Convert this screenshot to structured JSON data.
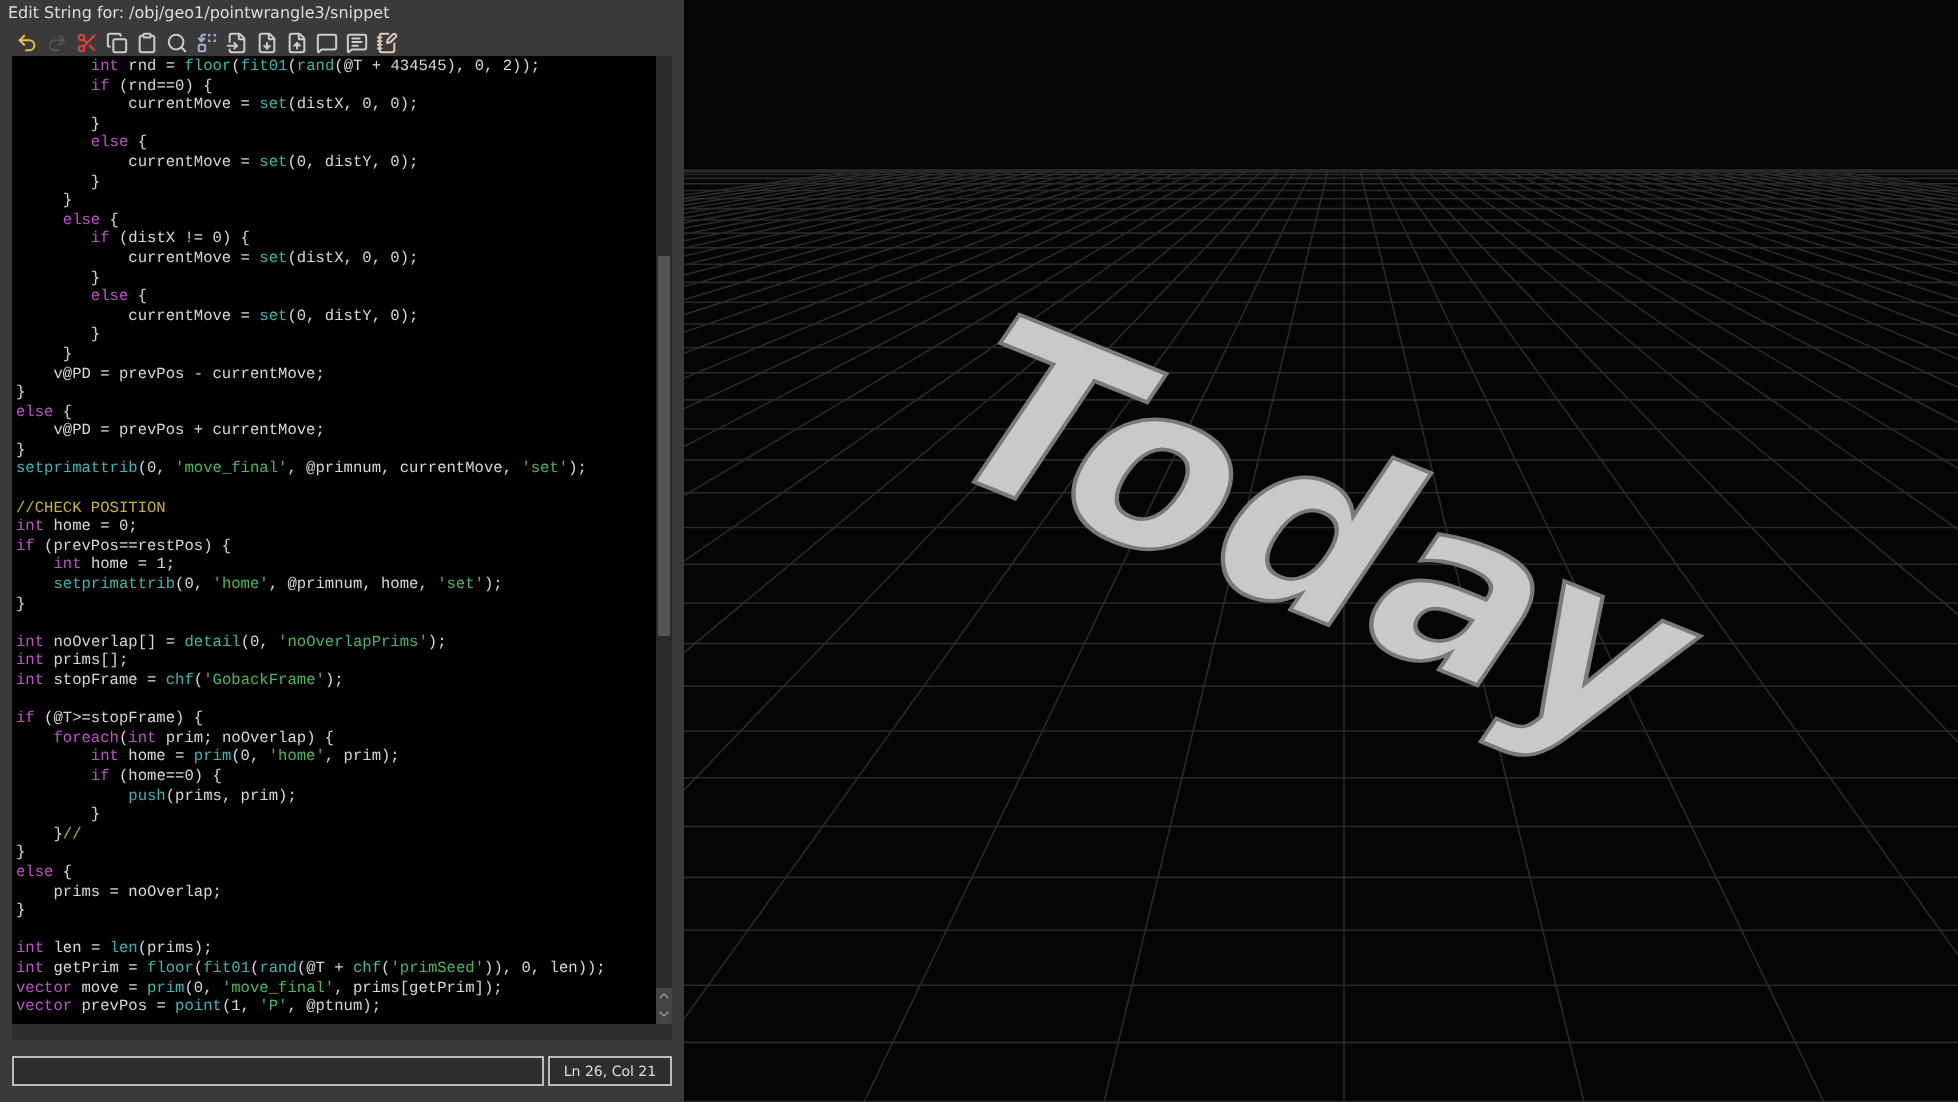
{
  "editor": {
    "title": "Edit String for: /obj/geo1/pointwrangle3/snippet",
    "toolbar": [
      {
        "disabled": false
      },
      {
        "disabled": true
      },
      {
        "disabled": false
      },
      {
        "disabled": false
      },
      {
        "disabled": false
      },
      {
        "disabled": false
      },
      {
        "disabled": false
      },
      {
        "disabled": false
      },
      {
        "disabled": false
      },
      {
        "disabled": false
      },
      {
        "disabled": false
      },
      {
        "disabled": false
      },
      {
        "disabled": false
      }
    ],
    "lines": [
      {
        "kind": "code",
        "tokens": [
          {
            "kind": "keyword",
            "text": "        int"
          },
          {
            "kind": "plain",
            "text": " rnd = "
          },
          {
            "kind": "func",
            "text": "floor"
          },
          {
            "kind": "plain",
            "text": "("
          },
          {
            "kind": "func",
            "text": "fit01"
          },
          {
            "kind": "plain",
            "text": "("
          },
          {
            "kind": "func",
            "text": "rand"
          },
          {
            "kind": "plain",
            "text": "(@T + 434545), 0, 2));"
          }
        ]
      },
      {
        "kind": "code",
        "tokens": [
          {
            "kind": "keyword",
            "text": "        if"
          },
          {
            "kind": "plain",
            "text": " (rnd==0) {"
          }
        ]
      },
      {
        "kind": "code",
        "tokens": [
          {
            "kind": "plain",
            "text": "            currentMove = "
          },
          {
            "kind": "func",
            "text": "set"
          },
          {
            "kind": "plain",
            "text": "(distX, 0, 0);"
          }
        ]
      },
      {
        "kind": "code",
        "tokens": [
          {
            "kind": "plain",
            "text": "        }"
          }
        ]
      },
      {
        "kind": "code",
        "tokens": [
          {
            "kind": "keyword",
            "text": "        else"
          },
          {
            "kind": "plain",
            "text": " {"
          }
        ]
      },
      {
        "kind": "code",
        "tokens": [
          {
            "kind": "plain",
            "text": "            currentMove = "
          },
          {
            "kind": "func",
            "text": "set"
          },
          {
            "kind": "plain",
            "text": "(0, distY, 0);"
          }
        ]
      },
      {
        "kind": "code",
        "tokens": [
          {
            "kind": "plain",
            "text": "        }"
          }
        ]
      },
      {
        "kind": "code",
        "tokens": [
          {
            "kind": "plain",
            "text": "     }"
          }
        ]
      },
      {
        "kind": "code",
        "tokens": [
          {
            "kind": "keyword",
            "text": "     else"
          },
          {
            "kind": "plain",
            "text": " {"
          }
        ]
      },
      {
        "kind": "code",
        "tokens": [
          {
            "kind": "keyword",
            "text": "        if"
          },
          {
            "kind": "plain",
            "text": " (distX != 0) {"
          }
        ]
      },
      {
        "kind": "code",
        "tokens": [
          {
            "kind": "plain",
            "text": "            currentMove = "
          },
          {
            "kind": "func",
            "text": "set"
          },
          {
            "kind": "plain",
            "text": "(distX, 0, 0);"
          }
        ]
      },
      {
        "kind": "code",
        "tokens": [
          {
            "kind": "plain",
            "text": "        }"
          }
        ]
      },
      {
        "kind": "code",
        "tokens": [
          {
            "kind": "keyword",
            "text": "        else"
          },
          {
            "kind": "plain",
            "text": " {"
          }
        ]
      },
      {
        "kind": "code",
        "tokens": [
          {
            "kind": "plain",
            "text": "            currentMove = "
          },
          {
            "kind": "func",
            "text": "set"
          },
          {
            "kind": "plain",
            "text": "(0, distY, 0);"
          }
        ]
      },
      {
        "kind": "code",
        "tokens": [
          {
            "kind": "plain",
            "text": "        }"
          }
        ]
      },
      {
        "kind": "code",
        "tokens": [
          {
            "kind": "plain",
            "text": "     }"
          }
        ]
      },
      {
        "kind": "code",
        "tokens": [
          {
            "kind": "plain",
            "text": "    v@PD = prevPos - currentMove;"
          }
        ]
      },
      {
        "kind": "code",
        "tokens": [
          {
            "kind": "plain",
            "text": "}"
          }
        ]
      },
      {
        "kind": "code",
        "tokens": [
          {
            "kind": "keyword",
            "text": "else"
          },
          {
            "kind": "plain",
            "text": " {"
          }
        ]
      },
      {
        "kind": "code",
        "tokens": [
          {
            "kind": "plain",
            "text": "    v@PD = prevPos + currentMove;"
          }
        ]
      },
      {
        "kind": "code",
        "tokens": [
          {
            "kind": "plain",
            "text": "}"
          }
        ]
      },
      {
        "kind": "code",
        "tokens": [
          {
            "kind": "func",
            "text": "setprimattrib"
          },
          {
            "kind": "plain",
            "text": "(0, "
          },
          {
            "kind": "string",
            "text": "'move_final'"
          },
          {
            "kind": "plain",
            "text": ", @primnum, currentMove, "
          },
          {
            "kind": "string",
            "text": "'set'"
          },
          {
            "kind": "plain",
            "text": ");"
          }
        ]
      },
      {
        "kind": "blank"
      },
      {
        "kind": "code",
        "tokens": [
          {
            "kind": "comment",
            "text": "//CHECK POSITION"
          }
        ]
      },
      {
        "kind": "code",
        "tokens": [
          {
            "kind": "keyword",
            "text": "int"
          },
          {
            "kind": "plain",
            "text": " home = 0;"
          }
        ]
      },
      {
        "kind": "code",
        "tokens": [
          {
            "kind": "keyword",
            "text": "if"
          },
          {
            "kind": "plain",
            "text": " (prevPos==restPos) {"
          }
        ]
      },
      {
        "kind": "code",
        "tokens": [
          {
            "kind": "keyword",
            "text": "    int"
          },
          {
            "kind": "plain",
            "text": " home = 1;"
          }
        ]
      },
      {
        "kind": "code",
        "tokens": [
          {
            "kind": "func",
            "text": "    setprimattrib"
          },
          {
            "kind": "plain",
            "text": "(0, "
          },
          {
            "kind": "string",
            "text": "'home'"
          },
          {
            "kind": "plain",
            "text": ", @primnum, home, "
          },
          {
            "kind": "string",
            "text": "'set'"
          },
          {
            "kind": "plain",
            "text": ");"
          }
        ]
      },
      {
        "kind": "code",
        "tokens": [
          {
            "kind": "plain",
            "text": "}"
          }
        ]
      },
      {
        "kind": "blank"
      },
      {
        "kind": "code",
        "tokens": [
          {
            "kind": "keyword",
            "text": "int"
          },
          {
            "kind": "plain",
            "text": " noOverlap[] = "
          },
          {
            "kind": "func",
            "text": "detail"
          },
          {
            "kind": "plain",
            "text": "(0, "
          },
          {
            "kind": "string",
            "text": "'noOverlapPrims'"
          },
          {
            "kind": "plain",
            "text": ");"
          }
        ]
      },
      {
        "kind": "code",
        "tokens": [
          {
            "kind": "keyword",
            "text": "int"
          },
          {
            "kind": "plain",
            "text": " prims[];"
          }
        ]
      },
      {
        "kind": "code",
        "tokens": [
          {
            "kind": "keyword",
            "text": "int"
          },
          {
            "kind": "plain",
            "text": " stopFrame = "
          },
          {
            "kind": "func",
            "text": "chf"
          },
          {
            "kind": "plain",
            "text": "("
          },
          {
            "kind": "string",
            "text": "'GobackFrame'"
          },
          {
            "kind": "plain",
            "text": ");"
          }
        ]
      },
      {
        "kind": "blank"
      },
      {
        "kind": "code",
        "tokens": [
          {
            "kind": "keyword",
            "text": "if"
          },
          {
            "kind": "plain",
            "text": " (@T>=stopFrame) {"
          }
        ]
      },
      {
        "kind": "code",
        "tokens": [
          {
            "kind": "keyword",
            "text": "    foreach"
          },
          {
            "kind": "plain",
            "text": "("
          },
          {
            "kind": "keyword",
            "text": "int"
          },
          {
            "kind": "plain",
            "text": " prim; noOverlap) {"
          }
        ]
      },
      {
        "kind": "code",
        "tokens": [
          {
            "kind": "keyword",
            "text": "        int"
          },
          {
            "kind": "plain",
            "text": " home = "
          },
          {
            "kind": "func",
            "text": "prim"
          },
          {
            "kind": "plain",
            "text": "(0, "
          },
          {
            "kind": "string",
            "text": "'home'"
          },
          {
            "kind": "plain",
            "text": ", prim);"
          }
        ]
      },
      {
        "kind": "code",
        "tokens": [
          {
            "kind": "keyword",
            "text": "        if"
          },
          {
            "kind": "plain",
            "text": " (home==0) {"
          }
        ]
      },
      {
        "kind": "code",
        "tokens": [
          {
            "kind": "func",
            "text": "            push"
          },
          {
            "kind": "plain",
            "text": "(prims, prim);"
          }
        ]
      },
      {
        "kind": "code",
        "tokens": [
          {
            "kind": "plain",
            "text": "        }"
          }
        ]
      },
      {
        "kind": "code",
        "tokens": [
          {
            "kind": "plain",
            "text": "    }"
          },
          {
            "kind": "comment",
            "text": "//"
          }
        ]
      },
      {
        "kind": "code",
        "tokens": [
          {
            "kind": "plain",
            "text": "}"
          }
        ]
      },
      {
        "kind": "code",
        "tokens": [
          {
            "kind": "keyword",
            "text": "else"
          },
          {
            "kind": "plain",
            "text": " {"
          }
        ]
      },
      {
        "kind": "code",
        "tokens": [
          {
            "kind": "plain",
            "text": "    prims = noOverlap;"
          }
        ]
      },
      {
        "kind": "code",
        "tokens": [
          {
            "kind": "plain",
            "text": "}"
          }
        ]
      },
      {
        "kind": "blank"
      },
      {
        "kind": "code",
        "tokens": [
          {
            "kind": "keyword",
            "text": "int"
          },
          {
            "kind": "plain",
            "text": " len = "
          },
          {
            "kind": "func",
            "text": "len"
          },
          {
            "kind": "plain",
            "text": "(prims);"
          }
        ]
      },
      {
        "kind": "code",
        "tokens": [
          {
            "kind": "keyword",
            "text": "int"
          },
          {
            "kind": "plain",
            "text": " getPrim = "
          },
          {
            "kind": "func",
            "text": "floor"
          },
          {
            "kind": "plain",
            "text": "("
          },
          {
            "kind": "func",
            "text": "fit01"
          },
          {
            "kind": "plain",
            "text": "("
          },
          {
            "kind": "func",
            "text": "rand"
          },
          {
            "kind": "plain",
            "text": "(@T + "
          },
          {
            "kind": "func",
            "text": "chf"
          },
          {
            "kind": "plain",
            "text": "("
          },
          {
            "kind": "string",
            "text": "'primSeed'"
          },
          {
            "kind": "plain",
            "text": ")), 0, len));"
          }
        ]
      },
      {
        "kind": "code",
        "tokens": [
          {
            "kind": "keyword",
            "text": "vector"
          },
          {
            "kind": "plain",
            "text": " move = "
          },
          {
            "kind": "func",
            "text": "prim"
          },
          {
            "kind": "plain",
            "text": "(0, "
          },
          {
            "kind": "string",
            "text": "'move_final'"
          },
          {
            "kind": "plain",
            "text": ", prims[getPrim]);"
          }
        ]
      },
      {
        "kind": "code",
        "tokens": [
          {
            "kind": "keyword",
            "text": "vector"
          },
          {
            "kind": "plain",
            "text": " prevPos = "
          },
          {
            "kind": "func",
            "text": "point"
          },
          {
            "kind": "plain",
            "text": "(1, "
          },
          {
            "kind": "string",
            "text": "'P'"
          },
          {
            "kind": "plain",
            "text": ", @ptnum);"
          }
        ]
      }
    ],
    "status": {
      "position": "Ln 26, Col 21"
    }
  },
  "viewport": {
    "object_text": "Today"
  }
}
